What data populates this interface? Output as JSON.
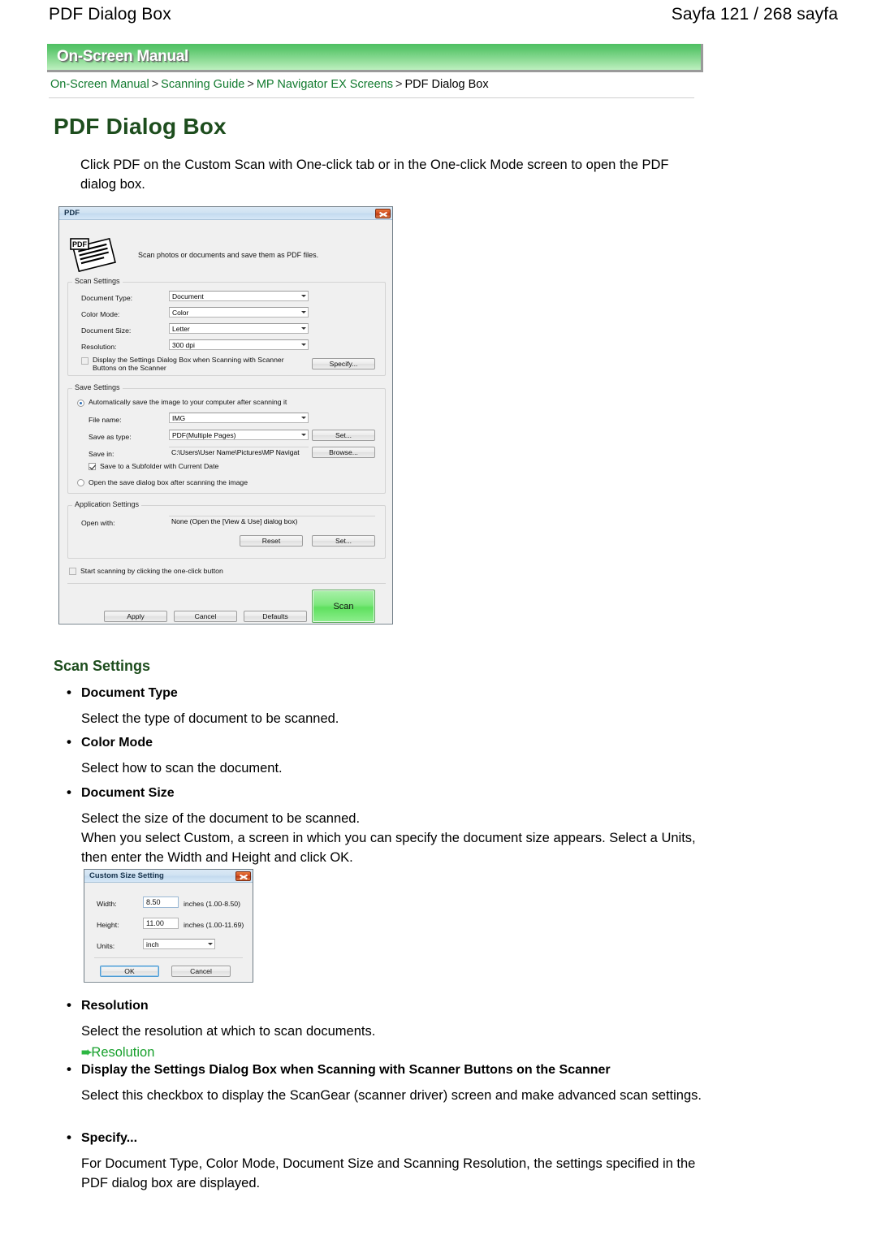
{
  "page_header": {
    "left_title": "PDF Dialog Box",
    "right_pagination": "Sayfa 121 / 268 sayfa"
  },
  "manual_bar": {
    "label": "On-Screen Manual",
    "gradient_top": "#4fbf62",
    "gradient_bottom": "#bdf0bf"
  },
  "breadcrumb": {
    "items": [
      {
        "label": "On-Screen Manual",
        "link": true
      },
      {
        "label": "Scanning Guide",
        "link": true
      },
      {
        "label": "MP Navigator EX Screens",
        "link": true
      },
      {
        "label": "PDF Dialog Box",
        "link": false
      }
    ],
    "separator": ">",
    "link_color": "#117a2e"
  },
  "document": {
    "title": "PDF Dialog Box",
    "title_color": "#1d4d1d",
    "intro": "Click PDF on the Custom Scan with One-click tab or in the One-click Mode screen to open the PDF dialog box."
  },
  "pdf_dialog": {
    "title": "PDF",
    "close_icon": "close-icon",
    "app_icon": "pdf-document-icon",
    "description": "Scan photos or documents and save them as PDF files.",
    "scan_settings": {
      "legend": "Scan Settings",
      "fields": [
        {
          "label": "Document Type:",
          "value": "Document"
        },
        {
          "label": "Color Mode:",
          "value": "Color"
        },
        {
          "label": "Document Size:",
          "value": "Letter"
        },
        {
          "label": "Resolution:",
          "value": "300 dpi"
        }
      ],
      "checkbox_label_line1": "Display the Settings Dialog Box when Scanning with Scanner",
      "checkbox_label_line2": "Buttons on the Scanner",
      "checkbox_checked": false,
      "specify_button": "Specify..."
    },
    "save_settings": {
      "legend": "Save Settings",
      "radio_auto": "Automatically save the image to your computer after scanning it",
      "radio_auto_selected": true,
      "file_name_label": "File name:",
      "file_name_value": "IMG",
      "save_as_type_label": "Save as  type:",
      "save_as_type_value": "PDF(Multiple Pages)",
      "save_as_type_button": "Set...",
      "save_in_label": "Save in:",
      "save_in_value": "C:\\Users\\User Name\\Pictures\\MP Navigat",
      "save_in_button": "Browse...",
      "subfolder_checkbox": "Save to a Subfolder with Current Date",
      "subfolder_checked": true,
      "radio_open_dialog": "Open the save dialog box after scanning the image",
      "radio_open_dialog_selected": false
    },
    "application_settings": {
      "legend": "Application Settings",
      "open_with_label": "Open with:",
      "open_with_value": "None (Open the [View & Use] dialog box)",
      "reset_button": "Reset",
      "set_button": "Set..."
    },
    "one_click_checkbox": "Start scanning by clicking the one-click button",
    "one_click_checked": false,
    "buttons": {
      "apply": "Apply",
      "cancel": "Cancel",
      "defaults": "Defaults",
      "scan": "Scan",
      "scan_color": "#5fe05f"
    }
  },
  "custom_size_dialog": {
    "title": "Custom Size Setting",
    "close_icon": "close-icon",
    "rows": [
      {
        "label": "Width:",
        "value": "8.50",
        "suffix": "inches (1.00-8.50)"
      },
      {
        "label": "Height:",
        "value": "11.00",
        "suffix": "inches (1.00-11.69)"
      }
    ],
    "units_label": "Units:",
    "units_value": "inch",
    "ok_button": "OK",
    "cancel_button": "Cancel"
  },
  "sections": {
    "scan_settings_heading": "Scan Settings",
    "items": [
      {
        "term": "Document Type",
        "desc": "Select the type of document to be scanned."
      },
      {
        "term": "Color Mode",
        "desc": "Select how to scan the document."
      },
      {
        "term": "Document Size",
        "desc": "Select the size of the document to be scanned.\nWhen you select Custom, a screen in which you can specify the document size appears. Select a Units, then enter the Width and Height and click OK."
      },
      {
        "term": "Resolution",
        "desc": "Select the resolution at which to scan documents.",
        "link": "Resolution"
      },
      {
        "term": "Display the Settings Dialog Box when Scanning with Scanner Buttons on the Scanner",
        "desc": "Select this checkbox to display the ScanGear (scanner driver) screen and make advanced scan settings."
      },
      {
        "term": "Specify...",
        "desc": "For Document Type, Color Mode, Document Size and Scanning Resolution, the settings specified in the PDF dialog box are displayed."
      }
    ]
  }
}
